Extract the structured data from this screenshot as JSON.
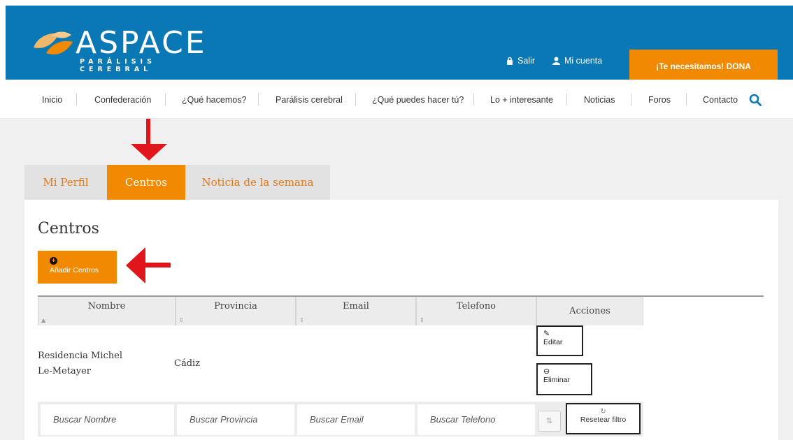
{
  "header": {
    "logo_word": "ASPACE",
    "logo_tagline": "PARÁLISIS CEREBRAL",
    "logout_label": "Salir",
    "account_label": "Mi cuenta",
    "donate_label": "¡Te necesitamos! DONA",
    "brand_color": "#0a78b4",
    "accent_color": "#f18a00"
  },
  "nav": {
    "items": [
      "Inicio",
      "Confederación",
      "¿Qué hacemos?",
      "Parálisis cerebral",
      "¿Qué puedes hacer tú?",
      "Lo + interesante",
      "Noticias",
      "Foros",
      "Contacto"
    ],
    "search_icon": "search-icon"
  },
  "tabs": [
    {
      "label": "Mi Perfil",
      "active": false
    },
    {
      "label": "Centros",
      "active": true
    },
    {
      "label": "Noticia de la semana",
      "active": false
    }
  ],
  "panel": {
    "title": "Centros",
    "add_button_label": "Añadir Centros",
    "add_icon": "plus-circle-icon"
  },
  "table": {
    "columns": [
      "Nombre",
      "Provincia",
      "Email",
      "Telefono",
      "Acciones"
    ],
    "rows": [
      {
        "nombre_line1": "Residencia Michel",
        "nombre_line2": "Le-Metayer",
        "provincia": "Cádiz",
        "email": "",
        "telefono": "",
        "edit_label": "Editar",
        "delete_label": "Eliminar"
      }
    ],
    "filters": {
      "nombre": "Buscar Nombre",
      "provincia": "Buscar Provincia",
      "email": "Buscar Email",
      "telefono": "Buscar Telefono",
      "reset_label": "Resetear filtro"
    }
  }
}
